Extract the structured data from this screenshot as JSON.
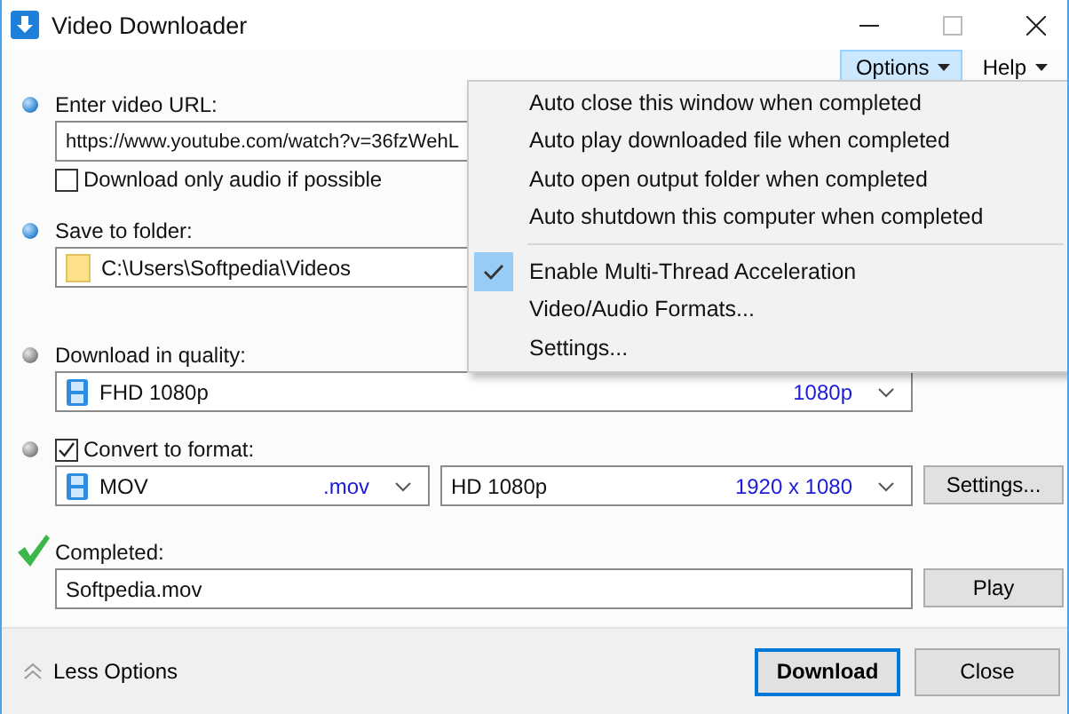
{
  "window": {
    "title": "Video Downloader"
  },
  "menu_bar": [
    {
      "label": "Options",
      "selected": true
    },
    {
      "label": "Help",
      "selected": false
    }
  ],
  "sections": [
    {
      "kind": "url",
      "active": true,
      "label": "Enter video URL:",
      "value": "https://www.youtube.com/watch?v=36fzWehL",
      "checkbox": {
        "label": "Download only audio if possible",
        "checked": false
      }
    },
    {
      "kind": "folder",
      "active": true,
      "label": "Save to folder:",
      "value": "C:\\Users\\Softpedia\\Videos"
    },
    {
      "kind": "quality",
      "active": false,
      "label": "Download in quality:",
      "value": "FHD 1080p",
      "detail": "1080p"
    },
    {
      "kind": "convert",
      "active": false,
      "label": "Convert to format:",
      "checked": true,
      "format": {
        "value": "MOV",
        "detail": ".mov"
      },
      "resolution": {
        "value": "HD 1080p",
        "detail": "1920 x 1080"
      },
      "button": "Settings..."
    },
    {
      "kind": "completed",
      "label": "Completed:",
      "value": "Softpedia.mov",
      "button": "Play"
    }
  ],
  "footer": {
    "toggle": "Less Options",
    "buttons": [
      {
        "label": "Download",
        "default": true
      },
      {
        "label": "Close",
        "default": false
      }
    ]
  },
  "options_menu": {
    "groups": [
      [
        {
          "label": "Auto close this window when completed",
          "checked": false
        },
        {
          "label": "Auto play downloaded file when completed",
          "checked": false
        },
        {
          "label": "Auto open output folder when completed",
          "checked": false
        },
        {
          "label": "Auto shutdown this computer when completed",
          "checked": false
        }
      ],
      [
        {
          "label": "Enable Multi-Thread Acceleration",
          "checked": true
        },
        {
          "label": "Video/Audio Formats...",
          "checked": false
        },
        {
          "label": "Settings...",
          "checked": false
        }
      ]
    ]
  }
}
